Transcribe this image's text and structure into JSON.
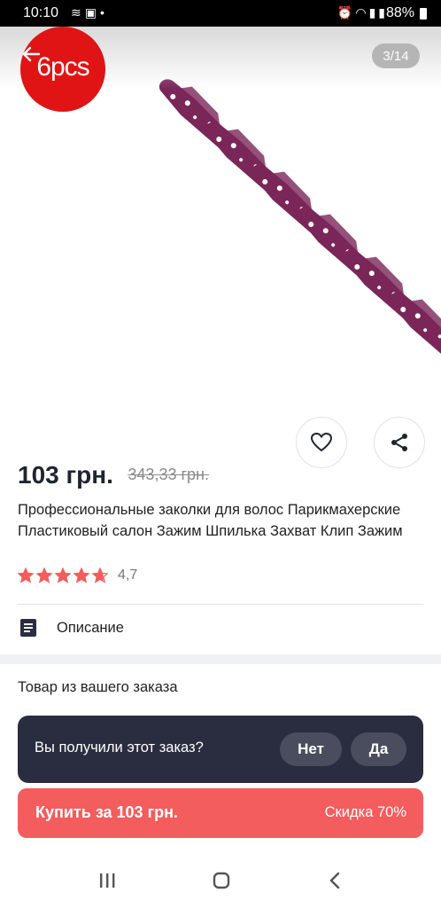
{
  "status_bar": {
    "time": "10:10",
    "battery": "88%",
    "left_icons": [
      "signal-waves-icon",
      "gallery-icon",
      "dot-icon"
    ],
    "right_icons": [
      "alarm-icon",
      "wifi-icon",
      "signal-icon",
      "signal-icon",
      "battery-icon"
    ]
  },
  "gallery": {
    "badge": "6pcs",
    "counter": "3/14",
    "product_color": "#7b2659",
    "clip_count": 6
  },
  "actions": {
    "favorite_icon": "heart-icon",
    "share_icon": "share-icon"
  },
  "product": {
    "price": "103 грн.",
    "old_price": "343,33 грн.",
    "title": "Профессиональные заколки для волос Парикмахерские Пластиковый салон Зажим Шпилька Захват Клип Зажим",
    "rating": "4,7",
    "rating_stars": 4.7,
    "star_color": "#f35d5d"
  },
  "description": {
    "label": "Описание",
    "icon": "document-icon"
  },
  "order": {
    "section_title": "Товар из вашего заказа",
    "question": "Вы получили этот заказ?",
    "no": "Нет",
    "yes": "Да"
  },
  "buy": {
    "label": "Купить за 103 грн.",
    "discount": "Скидка 70%",
    "color": "#f35d5d"
  },
  "nav": {
    "icons": [
      "recent-apps-icon",
      "home-icon",
      "back-icon"
    ]
  }
}
